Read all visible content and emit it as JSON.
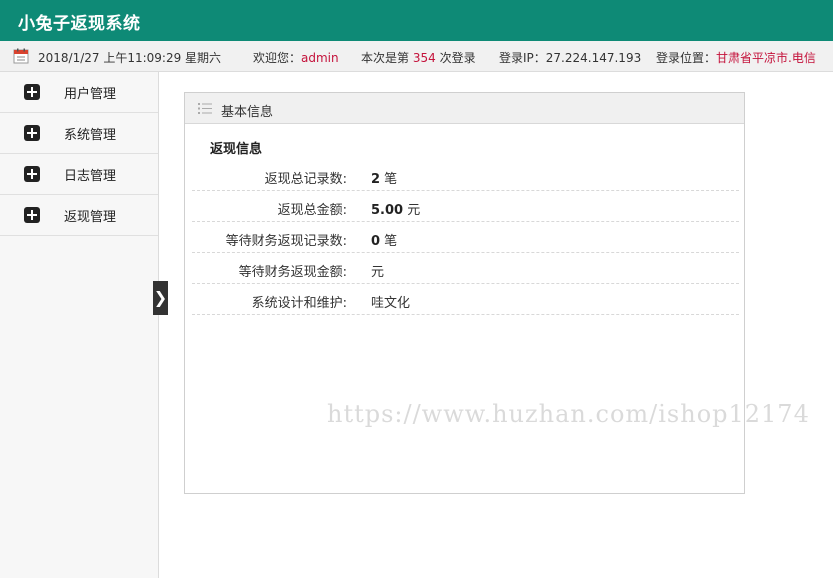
{
  "app": {
    "title": "小兔子返现系统"
  },
  "infobar": {
    "datetime": "2018/1/27 上午11:09:29 星期六",
    "welcome_label": "欢迎您：",
    "username": "admin",
    "login_count_prefix": "本次是第",
    "login_count": "354",
    "login_count_suffix": "次登录",
    "ip_label": "登录IP：",
    "ip": "27.224.147.193",
    "location_label": "登录位置：",
    "location": "甘肃省平凉市.电信",
    "accent_color": "#c4123b"
  },
  "sidebar": {
    "items": [
      {
        "label": "用户管理",
        "icon": "plus-square-icon"
      },
      {
        "label": "系统管理",
        "icon": "plus-square-icon"
      },
      {
        "label": "日志管理",
        "icon": "plus-square-icon"
      },
      {
        "label": "返现管理",
        "icon": "plus-square-icon"
      }
    ],
    "toggle_glyph": "❯"
  },
  "panel": {
    "title": "基本信息",
    "section_title": "返现信息",
    "rows": [
      {
        "key": "返现总记录数:",
        "value": "2",
        "unit": " 笔"
      },
      {
        "key": "返现总金额:",
        "value": "5.00",
        "unit": " 元"
      },
      {
        "key": "等待财务返现记录数:",
        "value": "0",
        "unit": " 笔"
      },
      {
        "key": "等待财务返现金额:",
        "value": "",
        "unit": "元"
      },
      {
        "key": "系统设计和维护:",
        "value": "",
        "unit": "哇文化"
      }
    ]
  },
  "watermark": "https://www.huzhan.com/ishop12174",
  "colors": {
    "header": "#0e8a76",
    "sidebar_bg": "#f7f7f7"
  }
}
